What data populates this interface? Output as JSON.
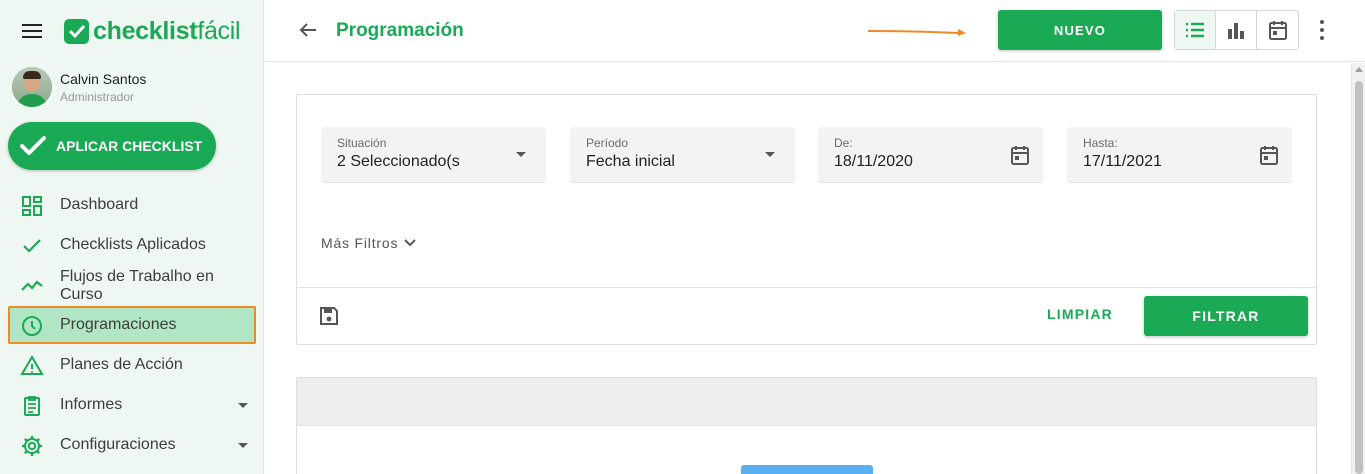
{
  "app": {
    "brand_bold": "checklist",
    "brand_light": "fácil",
    "accent_color": "#1aaa55",
    "highlight_color": "#f08a24"
  },
  "user": {
    "name": "Calvin Santos",
    "role": "Administrador"
  },
  "sidebar": {
    "apply_label": "APLICAR CHECKLIST",
    "items": [
      {
        "label": "Dashboard",
        "icon": "dashboard-icon"
      },
      {
        "label": "Checklists Aplicados",
        "icon": "check-icon"
      },
      {
        "label": "Flujos de Trabalho en Curso",
        "icon": "trending-icon"
      },
      {
        "label": "Programaciones",
        "icon": "clock-icon",
        "active": true
      },
      {
        "label": "Planes de Acción",
        "icon": "warning-icon"
      },
      {
        "label": "Informes",
        "icon": "report-icon",
        "expandable": true
      },
      {
        "label": "Configuraciones",
        "icon": "gear-icon",
        "expandable": true
      }
    ]
  },
  "header": {
    "title": "Programación",
    "new_label": "NUEVO",
    "views": [
      "list-view-icon",
      "chart-view-icon",
      "calendar-view-icon"
    ]
  },
  "filters": {
    "situacion": {
      "label": "Situación",
      "value": "2 Seleccionado(s"
    },
    "periodo": {
      "label": "Período",
      "value": "Fecha inicial"
    },
    "de": {
      "label": "De:",
      "value": "18/11/2020"
    },
    "hasta": {
      "label": "Hasta:",
      "value": "17/11/2021"
    },
    "more_label": "Más Filtros",
    "clear_label": "LIMPIAR",
    "filter_label": "FILTRAR"
  }
}
